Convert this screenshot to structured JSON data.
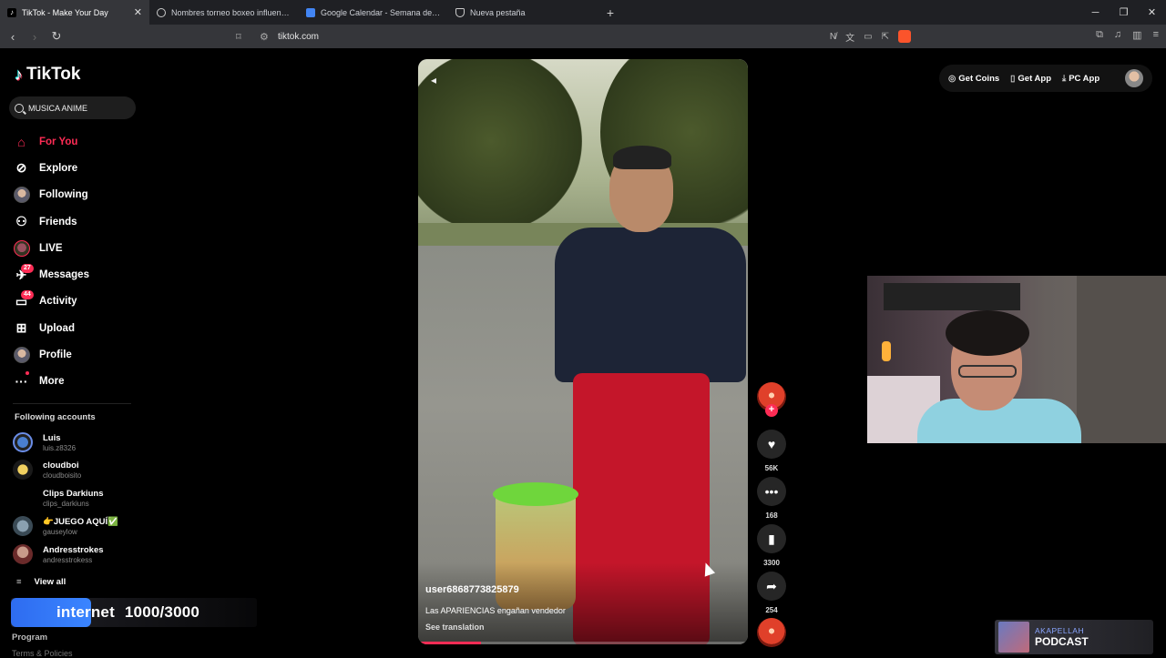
{
  "browser": {
    "tabs": [
      {
        "title": "TikTok - Make Your Day",
        "active": true,
        "icon": "tiktok-icon"
      },
      {
        "title": "Nombres torneo boxeo influencers",
        "active": false,
        "icon": "chatgpt-icon"
      },
      {
        "title": "Google Calendar - Semana del 15 de",
        "active": false,
        "icon": "calendar-icon"
      },
      {
        "title": "Nueva pestaña",
        "active": false,
        "icon": "shield-icon"
      }
    ],
    "new_tab_label": "+",
    "url": "tiktok.com"
  },
  "tiktok": {
    "logo_text": "TikTok",
    "search_value": "MUSICA ANIME",
    "nav": [
      {
        "label": "For You",
        "icon": "home-icon",
        "active": true
      },
      {
        "label": "Explore",
        "icon": "compass-icon"
      },
      {
        "label": "Following",
        "icon": "following-avatar-icon"
      },
      {
        "label": "Friends",
        "icon": "friends-icon"
      },
      {
        "label": "LIVE",
        "icon": "live-icon"
      },
      {
        "label": "Messages",
        "icon": "messages-icon",
        "badge": "27"
      },
      {
        "label": "Activity",
        "icon": "activity-icon",
        "badge": "44"
      },
      {
        "label": "Upload",
        "icon": "upload-icon"
      },
      {
        "label": "Profile",
        "icon": "profile-avatar-icon"
      },
      {
        "label": "More",
        "icon": "more-icon"
      }
    ],
    "following_title": "Following accounts",
    "accounts": [
      {
        "name": "Luis",
        "handle": "luis.z8326"
      },
      {
        "name": "cloudboi",
        "handle": "cloudboisito"
      },
      {
        "name": "Clips Darkiuns",
        "handle": "clips_darkiuns"
      },
      {
        "name": "👉JUEGO AQUÍ✅",
        "handle": "gauseylow"
      },
      {
        "name": "Andresstrokes",
        "handle": "andresstrokess"
      }
    ],
    "view_all": "View all",
    "program": "Program",
    "terms": "Terms & Policies",
    "top_right": {
      "get_coins": "Get Coins",
      "get_app": "Get App",
      "pc_app": "PC App"
    },
    "video": {
      "username": "user6868773825879",
      "description": "Las APARIENCIAS engañan vendedor",
      "see_translation": "See translation",
      "progress": 0.19
    },
    "actions": {
      "likes": "56K",
      "comments": "168",
      "saves": "3300",
      "shares": "254"
    }
  },
  "stream_overlay": {
    "internet_label": "internet",
    "goal": "1000/3000",
    "podcast_top": "AKAPELLAH",
    "podcast_label": "PODCAST"
  },
  "colors": {
    "accent": "#fe2c55",
    "chrome_bg": "#35363a",
    "tabbar_bg": "#1f2024",
    "page_bg": "#000000"
  }
}
